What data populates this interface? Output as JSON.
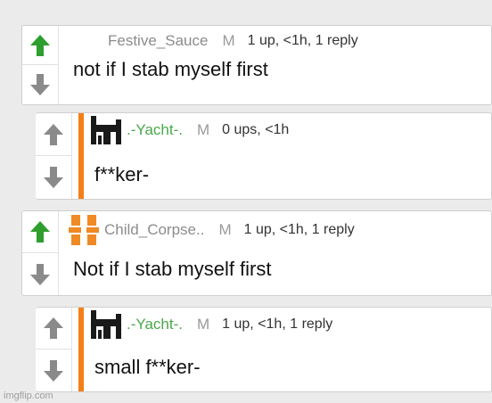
{
  "comments": [
    {
      "username": "Festive_Sauce",
      "badge": "M",
      "meta": "1 up, <1h, 1 reply",
      "text": "not if I stab myself first",
      "upvoted": true
    },
    {
      "username": ".-Yacht-.",
      "badge": "M",
      "meta": "0 ups, <1h",
      "text": "f**ker-",
      "upvoted": false
    },
    {
      "username": "Child_Corpse..",
      "badge": "M",
      "meta": "1 up, <1h, 1 reply",
      "text": "Not if I stab myself first",
      "upvoted": true
    },
    {
      "username": ".-Yacht-.",
      "badge": "M",
      "meta": "1 up, <1h, 1 reply",
      "text": "small f**ker-",
      "upvoted": false
    }
  ],
  "watermark": "imgflip.com",
  "colors": {
    "upvote_active": "#2e9e2e",
    "vote_inactive": "#8a8a8a",
    "reply_bar": "#f57f17",
    "username_green": "#4aa84a",
    "avatar_orange": "#f08a24"
  }
}
